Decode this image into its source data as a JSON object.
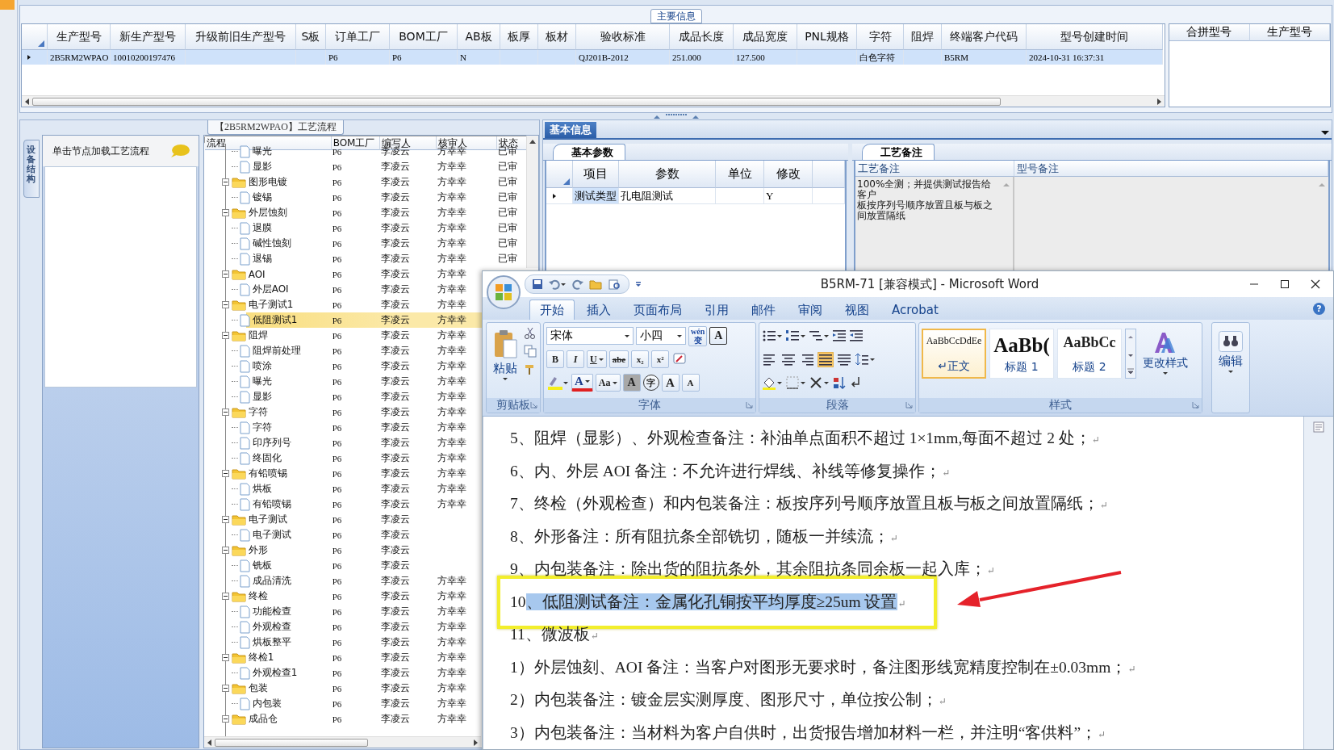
{
  "main_info": {
    "title": "主要信息",
    "columns": [
      "生产型号",
      "新生产型号",
      "升级前旧生产型号",
      "S板",
      "订单工厂",
      "BOM工厂",
      "AB板",
      "板厚",
      "板材",
      "验收标准",
      "成品长度",
      "成品宽度",
      "PNL规格",
      "字符",
      "阻焊",
      "终端客户代码",
      "型号创建时间"
    ],
    "rows": [
      {
        "selected": true,
        "cells": [
          "2B5RM2WPAO",
          "10010200197476",
          null,
          null,
          "P6",
          "P6",
          "N",
          null,
          null,
          "QJ201B-2012",
          "251.000",
          "127.500",
          null,
          "白色字符",
          null,
          "B5RM",
          "2024-10-31 16:37:31"
        ]
      }
    ],
    "side_columns": [
      "合拼型号",
      "生产型号"
    ]
  },
  "flow_panel": {
    "title": "【2B5RM2WPAO】工艺流程",
    "side_tab": "设备结构",
    "hint": "单击节点加载工艺流程",
    "columns": [
      "流程",
      "BOM工厂",
      "编写人",
      "核审人",
      "状态"
    ],
    "tree": [
      {
        "kind": "continuation",
        "children": [
          {
            "kind": "file",
            "label": "曝光",
            "bom": "P6",
            "author": "李凌云",
            "reviewer": "方幸幸",
            "status": "已审",
            "selected": false
          },
          {
            "kind": "file",
            "label": "显影",
            "bom": "P6",
            "author": "李凌云",
            "reviewer": "方幸幸",
            "status": "已审",
            "selected": false
          }
        ]
      },
      {
        "kind": "folder",
        "label": "图形电镀",
        "bom": "P6",
        "author": "李凌云",
        "reviewer": "方幸幸",
        "status": "已审",
        "selected": false,
        "expanded": true,
        "children": [
          {
            "kind": "file",
            "label": "镀锡",
            "bom": "P6",
            "author": "李凌云",
            "reviewer": "方幸幸",
            "status": "已审",
            "selected": false
          }
        ]
      },
      {
        "kind": "folder",
        "label": "外层蚀刻",
        "bom": "P6",
        "author": "李凌云",
        "reviewer": "方幸幸",
        "status": "已审",
        "selected": false,
        "expanded": true,
        "children": [
          {
            "kind": "file",
            "label": "退膜",
            "bom": "P6",
            "author": "李凌云",
            "reviewer": "方幸幸",
            "status": "已审",
            "selected": false
          },
          {
            "kind": "file",
            "label": "碱性蚀刻",
            "bom": "P6",
            "author": "李凌云",
            "reviewer": "方幸幸",
            "status": "已审",
            "selected": false
          },
          {
            "kind": "file",
            "label": "退锡",
            "bom": "P6",
            "author": "李凌云",
            "reviewer": "方幸幸",
            "status": "已审",
            "selected": false
          }
        ]
      },
      {
        "kind": "folder",
        "label": "AOI",
        "bom": "P6",
        "author": "李凌云",
        "reviewer": "方幸幸",
        "selected": false,
        "expanded": true,
        "children": [
          {
            "kind": "file",
            "label": "外层AOI",
            "bom": "P6",
            "author": "李凌云",
            "reviewer": "方幸幸",
            "selected": false
          }
        ]
      },
      {
        "kind": "folder",
        "label": "电子测试1",
        "bom": "P6",
        "author": "李凌云",
        "reviewer": "方幸幸",
        "selected": false,
        "expanded": true,
        "children": [
          {
            "kind": "file",
            "label": "低阻测试1",
            "bom": "P6",
            "author": "李凌云",
            "reviewer": "方幸幸",
            "selected": true
          }
        ]
      },
      {
        "kind": "folder",
        "label": "阻焊",
        "bom": "P6",
        "author": "李凌云",
        "reviewer": "方幸幸",
        "selected": false,
        "expanded": true,
        "children": [
          {
            "kind": "file",
            "label": "阻焊前处理",
            "bom": "P6",
            "author": "李凌云",
            "reviewer": "方幸幸",
            "selected": false
          },
          {
            "kind": "file",
            "label": "喷涂",
            "bom": "P6",
            "author": "李凌云",
            "reviewer": "方幸幸",
            "selected": false
          },
          {
            "kind": "file",
            "label": "曝光",
            "bom": "P6",
            "author": "李凌云",
            "reviewer": "方幸幸",
            "selected": false
          },
          {
            "kind": "file",
            "label": "显影",
            "bom": "P6",
            "author": "李凌云",
            "reviewer": "方幸幸",
            "selected": false
          }
        ]
      },
      {
        "kind": "folder",
        "label": "字符",
        "bom": "P6",
        "author": "李凌云",
        "reviewer": "方幸幸",
        "selected": false,
        "expanded": true,
        "children": [
          {
            "kind": "file",
            "label": "字符",
            "bom": "P6",
            "author": "李凌云",
            "reviewer": "方幸幸",
            "selected": false
          },
          {
            "kind": "file",
            "label": "印序列号",
            "bom": "P6",
            "author": "李凌云",
            "reviewer": "方幸幸",
            "selected": false
          },
          {
            "kind": "file",
            "label": "终固化",
            "bom": "P6",
            "author": "李凌云",
            "reviewer": "方幸幸",
            "selected": false
          }
        ]
      },
      {
        "kind": "folder",
        "label": "有铅喷锡",
        "bom": "P6",
        "author": "李凌云",
        "reviewer": "方幸幸",
        "selected": false,
        "expanded": true,
        "children": [
          {
            "kind": "file",
            "label": "烘板",
            "bom": "P6",
            "author": "李凌云",
            "reviewer": "方幸幸",
            "selected": false
          },
          {
            "kind": "file",
            "label": "有铅喷锡",
            "bom": "P6",
            "author": "李凌云",
            "reviewer": "方幸幸",
            "selected": false
          }
        ]
      },
      {
        "kind": "folder",
        "label": "电子测试",
        "bom": "P6",
        "author": "李凌云",
        "selected": false,
        "expanded": true,
        "children": [
          {
            "kind": "file",
            "label": "电子测试",
            "bom": "P6",
            "author": "李凌云",
            "selected": false
          }
        ]
      },
      {
        "kind": "folder",
        "label": "外形",
        "bom": "P6",
        "author": "李凌云",
        "selected": false,
        "expanded": true,
        "children": [
          {
            "kind": "file",
            "label": "铣板",
            "bom": "P6",
            "author": "李凌云",
            "selected": false
          },
          {
            "kind": "file",
            "label": "成品清洗",
            "bom": "P6",
            "author": "李凌云",
            "reviewer": "方幸幸",
            "selected": false
          }
        ]
      },
      {
        "kind": "folder",
        "label": "终检",
        "bom": "P6",
        "author": "李凌云",
        "reviewer": "方幸幸",
        "selected": false,
        "expanded": true,
        "children": [
          {
            "kind": "file",
            "label": "功能检查",
            "bom": "P6",
            "author": "李凌云",
            "reviewer": "方幸幸",
            "selected": false
          },
          {
            "kind": "file",
            "label": "外观检查",
            "bom": "P6",
            "author": "李凌云",
            "reviewer": "方幸幸",
            "selected": false
          },
          {
            "kind": "file",
            "label": "烘板整平",
            "bom": "P6",
            "author": "李凌云",
            "reviewer": "方幸幸",
            "selected": false
          }
        ]
      },
      {
        "kind": "folder",
        "label": "终检1",
        "bom": "P6",
        "author": "李凌云",
        "reviewer": "方幸幸",
        "selected": false,
        "expanded": true,
        "children": [
          {
            "kind": "file",
            "label": "外观检查1",
            "bom": "P6",
            "author": "李凌云",
            "reviewer": "方幸幸",
            "selected": false
          }
        ]
      },
      {
        "kind": "folder",
        "label": "包装",
        "bom": "P6",
        "author": "李凌云",
        "reviewer": "方幸幸",
        "selected": false,
        "expanded": true,
        "children": [
          {
            "kind": "file",
            "label": "内包装",
            "bom": "P6",
            "author": "李凌云",
            "reviewer": "方幸幸",
            "selected": false
          }
        ]
      },
      {
        "kind": "folder",
        "label": "成品仓",
        "bom": "P6",
        "author": "李凌云",
        "reviewer": "方幸幸",
        "selected": false,
        "expanded": true
      }
    ]
  },
  "info_panel": {
    "tab": "基本信息",
    "params": {
      "tab": "基本参数",
      "columns": [
        "项目",
        "参数",
        "单位",
        "修改"
      ],
      "rows": [
        {
          "selected": true,
          "cells": [
            "测试类型",
            "孔电阻测试",
            null,
            "Y"
          ]
        }
      ]
    },
    "notes": {
      "tab": "工艺备注",
      "columns": [
        "工艺备注",
        "型号备注"
      ],
      "text": [
        "100%全测；并提供测试报告给客户",
        "板按序列号顺序放置且板与板之间放置隔纸"
      ]
    }
  },
  "word": {
    "title": "B5RM-71 [兼容模式] - Microsoft Word",
    "tabs": [
      {
        "label": "开始",
        "selected": true
      },
      {
        "label": "插入",
        "selected": false
      },
      {
        "label": "页面布局",
        "selected": false
      },
      {
        "label": "引用",
        "selected": false
      },
      {
        "label": "邮件",
        "selected": false
      },
      {
        "label": "审阅",
        "selected": false
      },
      {
        "label": "视图",
        "selected": false
      },
      {
        "label": "Acrobat",
        "selected": false
      }
    ],
    "help": "?",
    "groups": [
      "剪贴板",
      "字体",
      "段落",
      "样式"
    ],
    "paste": "粘贴",
    "font_name": "宋体",
    "font_size": "小四",
    "phonetic": "wén\n变",
    "font_tools": [
      {
        "kind": "border",
        "label": "A"
      },
      {
        "kind": "bold",
        "label": "B"
      },
      {
        "kind": "italic",
        "label": "I"
      },
      {
        "kind": "underline",
        "label": "U"
      },
      {
        "kind": "strike",
        "label": "abe"
      },
      {
        "kind": "sub",
        "label": "x₂"
      },
      {
        "kind": "sup",
        "label": "x²"
      },
      {
        "kind": "color",
        "label": "A"
      },
      {
        "kind": "case",
        "label": "Aa"
      },
      {
        "kind": "shade",
        "label": "A"
      },
      {
        "kind": "enclose",
        "label": "字"
      },
      {
        "kind": "grow",
        "label": "A"
      },
      {
        "kind": "shrink",
        "label": "A"
      }
    ],
    "alignments": [
      {
        "kind": "left",
        "selected": false
      },
      {
        "kind": "center",
        "selected": false
      },
      {
        "kind": "right",
        "selected": false
      },
      {
        "kind": "justify",
        "selected": true
      },
      {
        "kind": "distributed",
        "selected": false
      }
    ],
    "styles": [
      {
        "kind": "normal",
        "preview": "AaBbCcDdEe",
        "label": "↵正文",
        "selected": true
      },
      {
        "kind": "heading1",
        "preview": "AaBb(",
        "label": "标题 1",
        "selected": false
      },
      {
        "kind": "heading2",
        "preview": "AaBbCc",
        "label": "标题 2",
        "selected": false
      }
    ],
    "change_styles": "更改样式",
    "editing": "编辑",
    "lines": [
      {
        "number": "5",
        "text": "、阻焊（显影）、外观检查备注：补油单点面积不超过 1×1mm,每面不超过 2 处；",
        "mark": "↵",
        "selected": false,
        "callout": false
      },
      {
        "number": "6",
        "text": "、内、外层 AOI 备注：不允许进行焊线、补线等修复操作；",
        "mark": "↵",
        "selected": false,
        "callout": false
      },
      {
        "number": "7",
        "text": "、终检（外观检查）和内包装备注：板按序列号顺序放置且板与板之间放置隔纸；",
        "mark": "↵",
        "selected": false,
        "callout": false
      },
      {
        "number": "8",
        "text": "、外形备注：所有阻抗条全部铣切，随板一并续流；",
        "mark": "↵",
        "selected": false,
        "callout": false
      },
      {
        "number": "9",
        "text": "、内包装备注：除出货的阻抗条外，其余阻抗条同余板一起入库；",
        "mark": "↵",
        "selected": false,
        "callout": false
      },
      {
        "number": "10",
        "text": "、低阻测试备注：金属化孔铜按平均厚度≥25um 设置",
        "mark": "↵",
        "selected": true,
        "callout": true
      },
      {
        "number": "11",
        "text": "、微波板",
        "mark": "↵",
        "selected": false,
        "callout": false
      },
      {
        "number": "1",
        "text": "）外层蚀刻、AOI 备注：当客户对图形无要求时，备注图形线宽精度控制在±0.03mm；",
        "mark": "↵",
        "selected": false,
        "callout": false
      },
      {
        "number": "2",
        "text": "）内包装备注：镀金层实测厚度、图形尺寸，单位按公制；",
        "mark": "↵",
        "selected": false,
        "callout": false
      },
      {
        "number": "3",
        "text": "）内包装备注：当材料为客户自供时，出货报告增加材料一栏，并注明“客供料”；",
        "mark": "↵",
        "selected": false,
        "callout": false
      }
    ]
  }
}
